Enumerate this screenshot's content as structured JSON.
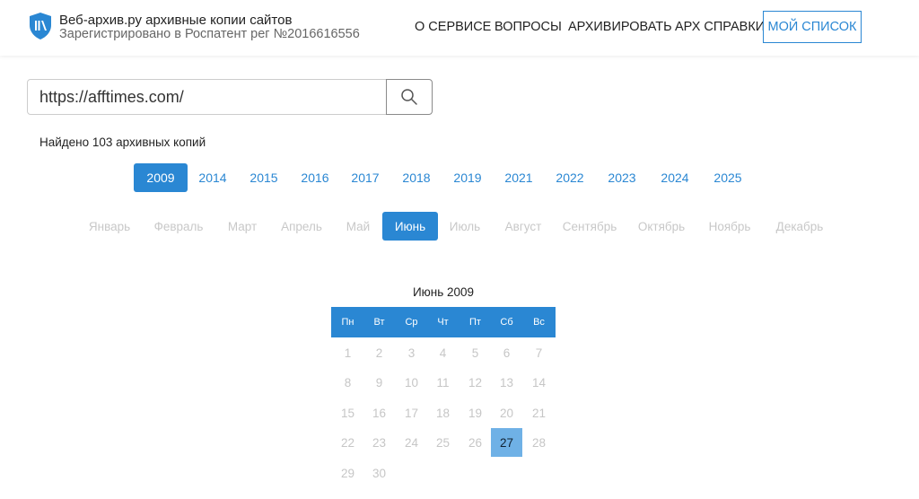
{
  "header": {
    "brand_title": "Веб-архив.ру архивные копии сайтов",
    "brand_subtitle": "Зарегистрировано в Роспатент рег №2016616556",
    "nav": [
      "О СЕРВИСЕ",
      "ВОПРОСЫ",
      "АРХИВИРОВАТЬ",
      "АРХ СПРАВКИ"
    ],
    "my_list": "МОЙ СПИСОК"
  },
  "search": {
    "value": "https://afftimes.com/"
  },
  "found_text": "Найдено 103 архивных копий",
  "years": [
    "2009",
    "2014",
    "2015",
    "2016",
    "2017",
    "2018",
    "2019",
    "2021",
    "2022",
    "2023",
    "2024",
    "2025"
  ],
  "active_year": "2009",
  "months": [
    "Январь",
    "Февраль",
    "Март",
    "Апрель",
    "Май",
    "Июнь",
    "Июль",
    "Август",
    "Сентябрь",
    "Октябрь",
    "Ноябрь",
    "Декабрь"
  ],
  "active_month": "Июнь",
  "calendar": {
    "title": "Июнь 2009",
    "weekdays": [
      "Пн",
      "Вт",
      "Ср",
      "Чт",
      "Пт",
      "Сб",
      "Вс"
    ],
    "weeks": [
      [
        "1",
        "2",
        "3",
        "4",
        "5",
        "6",
        "7"
      ],
      [
        "8",
        "9",
        "10",
        "11",
        "12",
        "13",
        "14"
      ],
      [
        "15",
        "16",
        "17",
        "18",
        "19",
        "20",
        "21"
      ],
      [
        "22",
        "23",
        "24",
        "25",
        "26",
        "27",
        "28"
      ],
      [
        "29",
        "30"
      ]
    ],
    "active_day": "27"
  },
  "colors": {
    "accent": "#2a87d3",
    "active_day": "#6fb1e6",
    "inactive": "#c8c8c8"
  },
  "icons": {
    "logo": "shield-logo-icon",
    "search": "search-icon"
  }
}
